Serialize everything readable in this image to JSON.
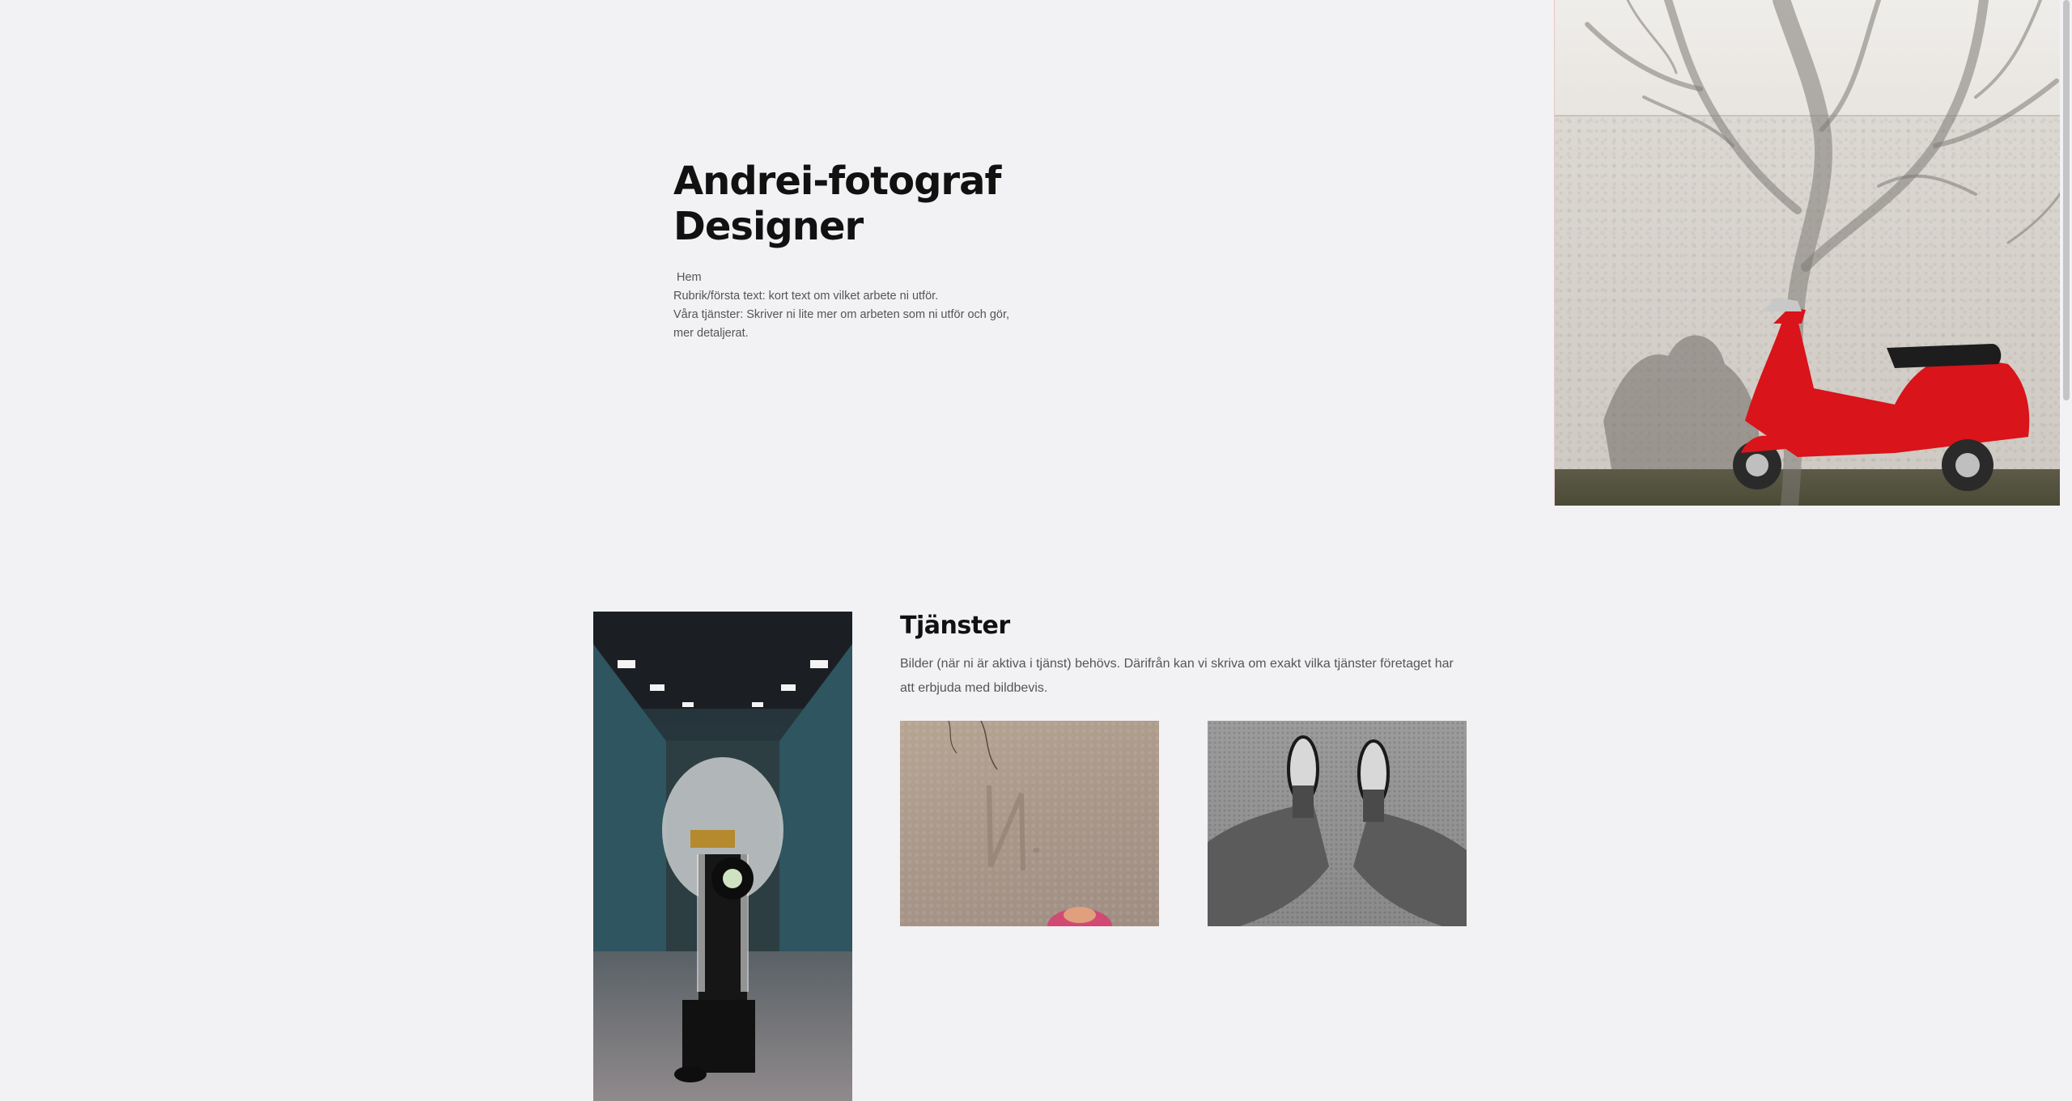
{
  "hero": {
    "title_line1": "Andrei-fotograf",
    "title_line2": "Designer",
    "nav_home": "Hem",
    "line1": "Rubrik/första text: kort text om vilket arbete ni utför.",
    "line2": "Våra tjänster: Skriver ni lite mer om arbeten som ni utför och gör, mer detaljerat."
  },
  "services": {
    "heading": "Tjänster",
    "body": "Bilder (när ni är aktiva i tjänst) behövs. Därifrån kan vi skriva om exakt vilka tjänster företaget har att erbjuda med bildbevis."
  },
  "images": {
    "hero": "red-scooter-photo",
    "portrait": "photographer-photo",
    "thumb1": "sand-photo",
    "thumb2": "feet-photo"
  },
  "colors": {
    "background": "#f2f1f3",
    "scooter_red": "#d9141a"
  }
}
